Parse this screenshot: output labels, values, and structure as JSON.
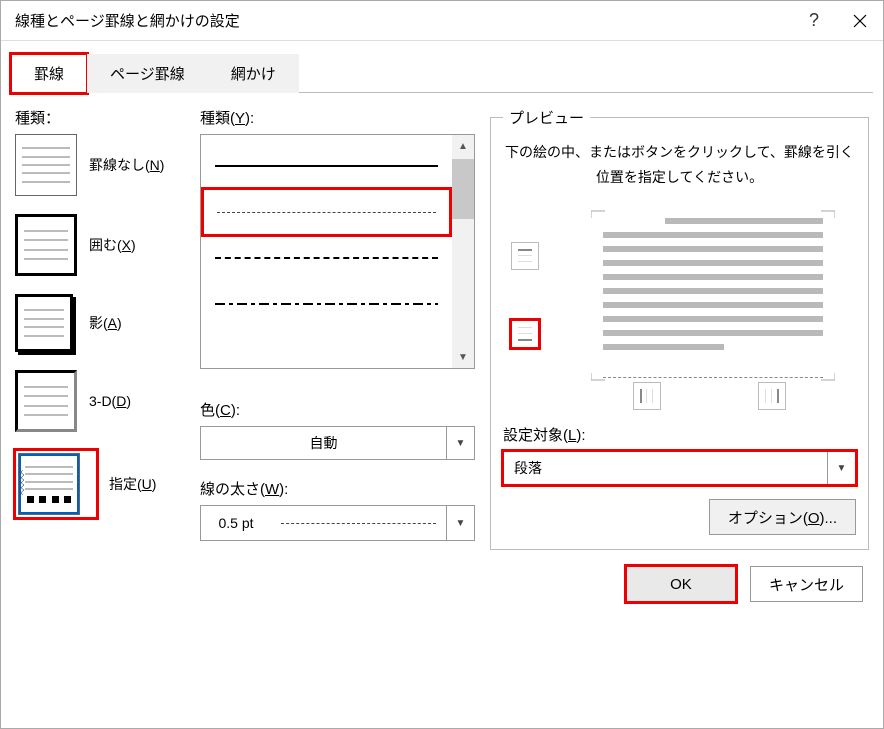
{
  "titlebar": {
    "title": "線種とページ罫線と網かけの設定"
  },
  "tabs": {
    "borders": "罫線",
    "pageBorders": "ページ罫線",
    "shading": "網かけ"
  },
  "left": {
    "heading": "種類：",
    "items": {
      "none": "罫線なし(N)",
      "box": "囲む(X)",
      "shadow": "影(A)",
      "threeD": "3-D(D)",
      "custom": "指定(U)"
    }
  },
  "mid": {
    "styleLabel": "種類(Y):",
    "colorLabel": "色(C):",
    "colorValue": "自動",
    "widthLabel": "線の太さ(W):",
    "widthValue": "0.5 pt"
  },
  "right": {
    "legend": "プレビュー",
    "instruction": "下の絵の中、またはボタンをクリックして、罫線を引く位置を指定してください。",
    "applyLabel": "設定対象(L):",
    "applyValue": "段落",
    "options": "オプション(O)..."
  },
  "footer": {
    "ok": "OK",
    "cancel": "キャンセル"
  }
}
